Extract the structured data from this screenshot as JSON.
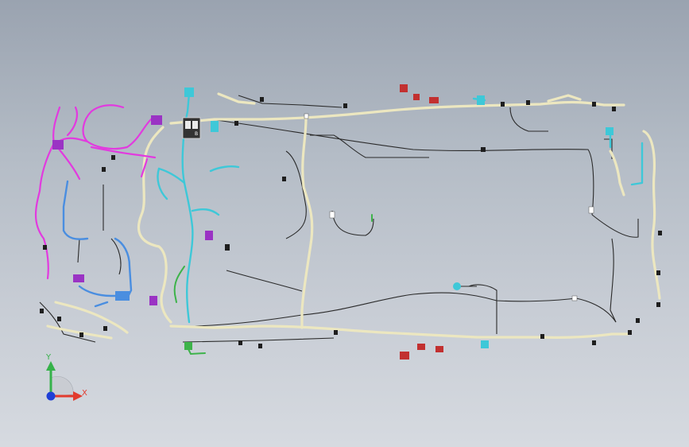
{
  "axis_triad": {
    "x_label": "X",
    "y_label": "Y",
    "x_color": "#e23b2e",
    "y_color": "#36b24a",
    "z_color": "#1f3fd6"
  },
  "colors": {
    "background_top": "#9aa3b0",
    "background_bottom": "#d6dae0",
    "main_harness": "#ece7c0",
    "thin_wire": "#2a2a2a",
    "magenta_branch": "#e23adf",
    "cyan_branch": "#3ec8d8",
    "blue_branch": "#4a8ee0",
    "purple_connector": "#9a33c4",
    "red_connector": "#c23030",
    "green_branch": "#3db34a"
  },
  "relay_box": {
    "label": "B"
  }
}
